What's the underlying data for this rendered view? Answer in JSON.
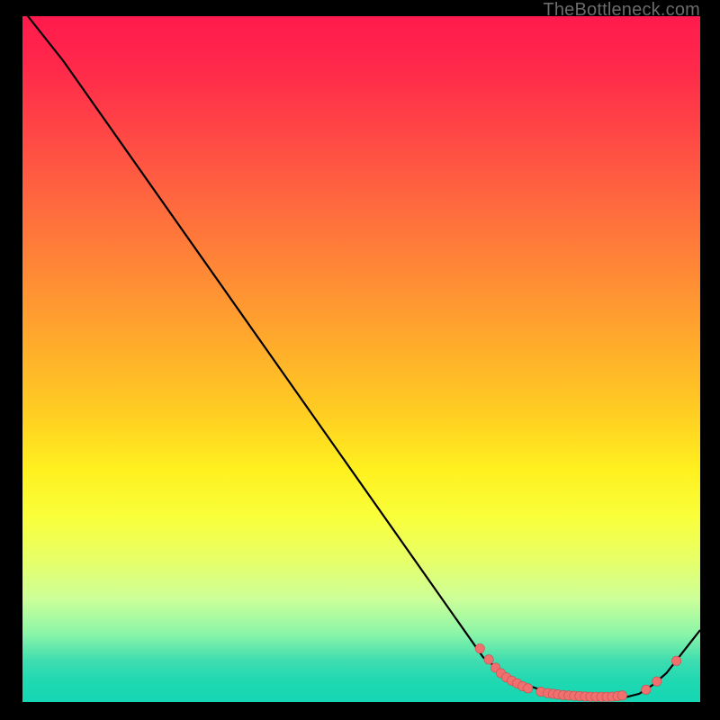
{
  "watermark": "TheBottleneck.com",
  "colors": {
    "line": "#000000",
    "marker_fill": "#f07070",
    "marker_stroke": "#c94f4f"
  },
  "chart_data": {
    "type": "line",
    "title": "",
    "xlabel": "",
    "ylabel": "",
    "legend": false,
    "grid": false,
    "xlim": [
      0,
      100
    ],
    "ylim": [
      0,
      100
    ],
    "series": [
      {
        "name": "curve",
        "x": [
          0,
          6,
          68,
          71,
          74,
          77,
          80,
          83,
          86,
          89,
          91,
          93,
          95,
          100
        ],
        "y": [
          101,
          93.5,
          6.5,
          4.2,
          2.6,
          1.6,
          1.0,
          0.7,
          0.6,
          0.7,
          1.2,
          2.5,
          4.2,
          10.5
        ]
      }
    ],
    "markers": [
      {
        "x": 67.5,
        "y": 7.8
      },
      {
        "x": 68.8,
        "y": 6.2
      },
      {
        "x": 69.8,
        "y": 5.0
      },
      {
        "x": 70.6,
        "y": 4.2
      },
      {
        "x": 71.4,
        "y": 3.6
      },
      {
        "x": 72.2,
        "y": 3.1
      },
      {
        "x": 73.0,
        "y": 2.7
      },
      {
        "x": 73.8,
        "y": 2.3
      },
      {
        "x": 74.6,
        "y": 2.0
      },
      {
        "x": 76.5,
        "y": 1.5
      },
      {
        "x": 77.5,
        "y": 1.3
      },
      {
        "x": 78.3,
        "y": 1.2
      },
      {
        "x": 79.0,
        "y": 1.1
      },
      {
        "x": 79.8,
        "y": 1.0
      },
      {
        "x": 80.6,
        "y": 0.95
      },
      {
        "x": 81.4,
        "y": 0.9
      },
      {
        "x": 82.2,
        "y": 0.85
      },
      {
        "x": 83.0,
        "y": 0.8
      },
      {
        "x": 83.8,
        "y": 0.78
      },
      {
        "x": 84.6,
        "y": 0.76
      },
      {
        "x": 85.4,
        "y": 0.75
      },
      {
        "x": 86.2,
        "y": 0.75
      },
      {
        "x": 87.0,
        "y": 0.78
      },
      {
        "x": 87.8,
        "y": 0.85
      },
      {
        "x": 88.5,
        "y": 0.95
      },
      {
        "x": 92.0,
        "y": 1.8
      },
      {
        "x": 93.6,
        "y": 3.0
      },
      {
        "x": 96.5,
        "y": 6.0
      }
    ]
  }
}
